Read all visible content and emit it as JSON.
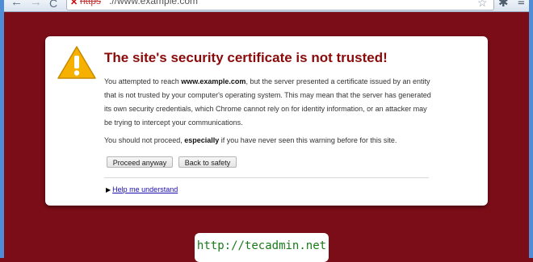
{
  "browser": {
    "url_scheme": "https",
    "url_rest": "://www.example.com",
    "icons": {
      "back": "back-arrow-icon",
      "forward": "forward-arrow-icon",
      "reload": "reload-icon",
      "insecure": "insecure-x-icon",
      "bookmark": "star-icon",
      "settings": "wrench-icon",
      "menu": "menu-icon"
    }
  },
  "interstitial": {
    "title": "The site's security certificate is not trusted!",
    "para1": {
      "before": "You attempted to reach ",
      "host": "www.example.com",
      "after": ", but the server presented a certificate issued by an entity that is not trusted by your computer's operating system. This may mean that the server has generated its own security credentials, which Chrome cannot rely on for identity information, or an attacker may be trying to intercept your communications."
    },
    "para2": {
      "before": "You should not proceed, ",
      "emphasis": "especially",
      "after": " if you have never seen this warning before for this site."
    },
    "proceed_label": "Proceed anyway",
    "back_label": "Back to safety",
    "help_label": "Help me understand",
    "colors": {
      "page_bg": "#7b0d18",
      "title": "#8b0a0a",
      "warning_icon": "#f5b000"
    }
  },
  "watermark": {
    "text": "http://tecadmin.net"
  }
}
